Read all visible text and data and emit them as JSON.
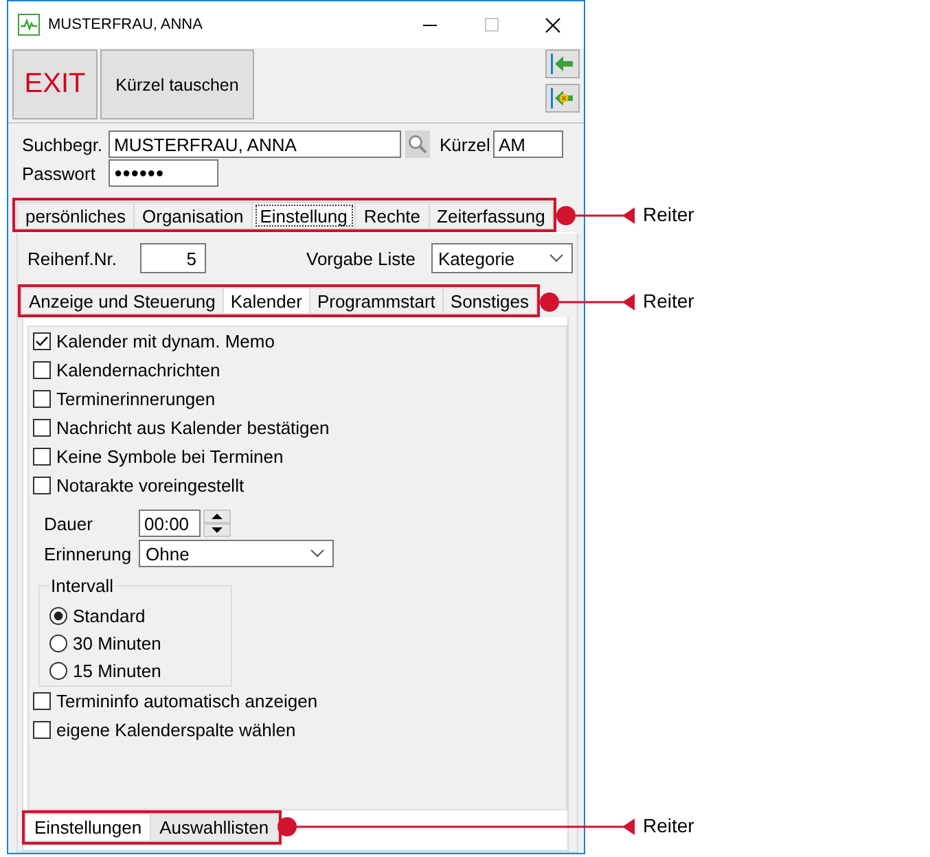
{
  "window": {
    "title": "MUSTERFRAU, ANNA"
  },
  "toolbar": {
    "buttons": [
      {
        "label": "EXIT",
        "kind": "exit"
      },
      {
        "label": "Kürzel tauschen",
        "kind": "plain"
      }
    ]
  },
  "search": {
    "label": "Suchbegr.",
    "value": "MUSTERFRAU, ANNA",
    "shortcut_label": "Kürzel",
    "shortcut_value": "AM",
    "password_label": "Passwort",
    "password_value": "●●●●●●"
  },
  "main_tabs": [
    {
      "label": "persönliches",
      "selected": false
    },
    {
      "label": "Organisation",
      "selected": false
    },
    {
      "label": "Einstellung",
      "selected": true
    },
    {
      "label": "Rechte",
      "selected": false
    },
    {
      "label": "Zeiterfassung",
      "selected": false
    }
  ],
  "settings": {
    "order_label": "Reihenf.Nr.",
    "order_value": "5",
    "list_label": "Vorgabe Liste",
    "list_value": "Kategorie"
  },
  "sub_tabs": [
    {
      "label": "Anzeige und Steuerung",
      "selected": false
    },
    {
      "label": "Kalender",
      "selected": true
    },
    {
      "label": "Programmstart",
      "selected": false
    },
    {
      "label": "Sonstiges",
      "selected": false
    }
  ],
  "calendar": {
    "options_top": [
      {
        "label": "Kalender mit dynam. Memo",
        "checked": true
      },
      {
        "label": "Kalendernachrichten",
        "checked": false
      },
      {
        "label": "Terminerinnerungen",
        "checked": false
      },
      {
        "label": "Nachricht aus Kalender bestätigen",
        "checked": false
      },
      {
        "label": "Keine Symbole bei Terminen",
        "checked": false
      },
      {
        "label": "Notarakte voreingestellt",
        "checked": false
      }
    ],
    "duration_label": "Dauer",
    "duration_value": "00:00",
    "reminder_label": "Erinnerung",
    "reminder_value": "Ohne",
    "interval": {
      "legend": "Intervall",
      "options": [
        {
          "label": "Standard",
          "selected": true
        },
        {
          "label": "30 Minuten",
          "selected": false
        },
        {
          "label": "15 Minuten",
          "selected": false
        }
      ]
    },
    "options_bottom": [
      {
        "label": "Termininfo automatisch anzeigen",
        "checked": false
      },
      {
        "label": "eigene Kalenderspalte wählen",
        "checked": false
      }
    ]
  },
  "bottom_tabs": [
    {
      "label": "Einstellungen",
      "selected": true
    },
    {
      "label": "Auswahllisten",
      "selected": false
    }
  ],
  "callouts": [
    {
      "label": "Reiter"
    },
    {
      "label": "Reiter"
    },
    {
      "label": "Reiter"
    }
  ]
}
